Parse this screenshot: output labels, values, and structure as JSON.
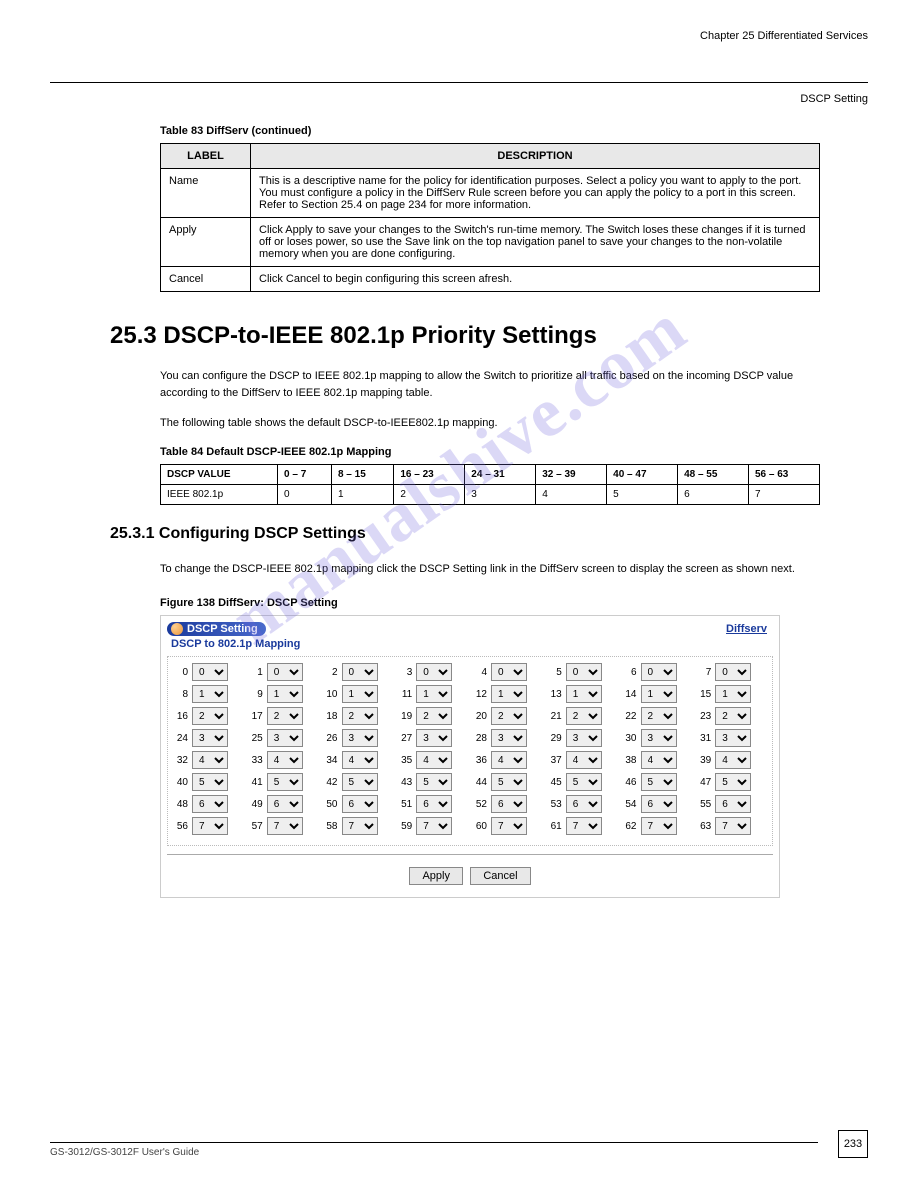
{
  "watermark": "manualshive.com",
  "chapter_ref": "Chapter 25 Differentiated Services",
  "section_ref": "DSCP Setting",
  "table1": {
    "caption": "Table 83   DiffServ (continued)",
    "headers": [
      "LABEL",
      "DESCRIPTION"
    ],
    "rows": [
      [
        "Name",
        "This is a descriptive name for the policy for identification purposes. Select a policy you want to apply to the port.\nYou must configure a policy in the DiffServ Rule screen before you can apply the policy to a port in this screen. Refer to Section 25.4 on page 234 for more information."
      ],
      [
        "Apply",
        "Click Apply to save your changes to the Switch's run-time memory. The Switch loses these changes if it is turned off or loses power, so use the Save link on the top navigation panel to save your changes to the non-volatile memory when you are done configuring."
      ],
      [
        "Cancel",
        "Click Cancel to begin configuring this screen afresh."
      ]
    ]
  },
  "section_heading": "25.3  DSCP-to-IEEE 802.1p Priority Settings",
  "paragraph1": "You can configure the DSCP to IEEE 802.1p mapping to allow the Switch to prioritize all traffic based on the incoming DSCP value according to the DiffServ to IEEE 802.1p mapping table.",
  "paragraph2": "The following table shows the default DSCP-to-IEEE802.1p mapping.",
  "table2": {
    "caption": "Table 84   Default DSCP-IEEE 802.1p Mapping",
    "headers": [
      "DSCP VALUE",
      "0 – 7",
      "8 – 15",
      "16 – 23",
      "24 – 31",
      "32 – 39",
      "40 – 47",
      "48 – 55",
      "56 – 63"
    ],
    "row_label": "IEEE 802.1p",
    "row_values": [
      "0",
      "1",
      "2",
      "3",
      "4",
      "5",
      "6",
      "7"
    ]
  },
  "subsection_heading": "25.3.1  Configuring DSCP Settings",
  "subsection_body": "To change the DSCP-IEEE 802.1p mapping click the DSCP Setting link in the DiffServ screen to display the screen as shown next.",
  "figure_caption": "Figure 138   DiffServ: DSCP Setting",
  "panel": {
    "pill_text": "DSCP Setting",
    "link_text": "Diffserv",
    "subtitle": "DSCP to 802.1p Mapping",
    "apply_label": "Apply",
    "cancel_label": "Cancel",
    "options": [
      "0",
      "1",
      "2",
      "3",
      "4",
      "5",
      "6",
      "7"
    ]
  },
  "chart_data": [
    {
      "type": "table",
      "title": "DSCP to 802.1p Mapping",
      "columns": [
        "DSCP",
        "802.1p"
      ],
      "rows": [
        [
          0,
          0
        ],
        [
          1,
          0
        ],
        [
          2,
          0
        ],
        [
          3,
          0
        ],
        [
          4,
          0
        ],
        [
          5,
          0
        ],
        [
          6,
          0
        ],
        [
          7,
          0
        ],
        [
          8,
          1
        ],
        [
          9,
          1
        ],
        [
          10,
          1
        ],
        [
          11,
          1
        ],
        [
          12,
          1
        ],
        [
          13,
          1
        ],
        [
          14,
          1
        ],
        [
          15,
          1
        ],
        [
          16,
          2
        ],
        [
          17,
          2
        ],
        [
          18,
          2
        ],
        [
          19,
          2
        ],
        [
          20,
          2
        ],
        [
          21,
          2
        ],
        [
          22,
          2
        ],
        [
          23,
          2
        ],
        [
          24,
          3
        ],
        [
          25,
          3
        ],
        [
          26,
          3
        ],
        [
          27,
          3
        ],
        [
          28,
          3
        ],
        [
          29,
          3
        ],
        [
          30,
          3
        ],
        [
          31,
          3
        ],
        [
          32,
          4
        ],
        [
          33,
          4
        ],
        [
          34,
          4
        ],
        [
          35,
          4
        ],
        [
          36,
          4
        ],
        [
          37,
          4
        ],
        [
          38,
          4
        ],
        [
          39,
          4
        ],
        [
          40,
          5
        ],
        [
          41,
          5
        ],
        [
          42,
          5
        ],
        [
          43,
          5
        ],
        [
          44,
          5
        ],
        [
          45,
          5
        ],
        [
          46,
          5
        ],
        [
          47,
          5
        ],
        [
          48,
          6
        ],
        [
          49,
          6
        ],
        [
          50,
          6
        ],
        [
          51,
          6
        ],
        [
          52,
          6
        ],
        [
          53,
          6
        ],
        [
          54,
          6
        ],
        [
          55,
          6
        ],
        [
          56,
          7
        ],
        [
          57,
          7
        ],
        [
          58,
          7
        ],
        [
          59,
          7
        ],
        [
          60,
          7
        ],
        [
          61,
          7
        ],
        [
          62,
          7
        ],
        [
          63,
          7
        ]
      ]
    }
  ],
  "footer_text": "GS-3012/GS-3012F User's Guide",
  "page_number": "233"
}
